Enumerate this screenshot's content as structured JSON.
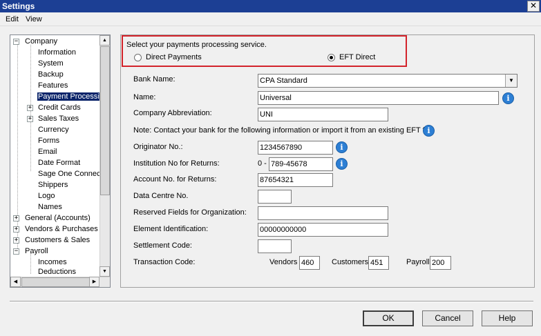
{
  "window": {
    "title": "Settings",
    "close_glyph": "✕"
  },
  "menu": {
    "items": [
      "Edit",
      "View"
    ]
  },
  "tree": {
    "items": [
      {
        "label": "Company",
        "expander": "−"
      },
      {
        "label": "Information"
      },
      {
        "label": "System"
      },
      {
        "label": "Backup"
      },
      {
        "label": "Features"
      },
      {
        "label": "Payment Processin",
        "selected": true
      },
      {
        "label": "Credit Cards",
        "expander": "+"
      },
      {
        "label": "Sales Taxes",
        "expander": "+"
      },
      {
        "label": "Currency"
      },
      {
        "label": "Forms"
      },
      {
        "label": "Email"
      },
      {
        "label": "Date Format"
      },
      {
        "label": "Sage One Connect"
      },
      {
        "label": "Shippers"
      },
      {
        "label": "Logo"
      },
      {
        "label": "Names"
      },
      {
        "label": "General (Accounts)",
        "expander": "+"
      },
      {
        "label": "Vendors & Purchases",
        "expander": "+"
      },
      {
        "label": "Customers & Sales",
        "expander": "+"
      },
      {
        "label": "Payroll",
        "expander": "−"
      },
      {
        "label": "Incomes"
      },
      {
        "label": "Deductions"
      }
    ],
    "scroll_up_glyph": "▲",
    "scroll_down_glyph": "▼",
    "scroll_left_glyph": "◀",
    "scroll_right_glyph": "▶"
  },
  "service": {
    "prompt": "Select your payments processing service.",
    "options": [
      {
        "label": "Direct Payments",
        "selected": false
      },
      {
        "label": "EFT Direct",
        "selected": true
      }
    ]
  },
  "form": {
    "bank_name_label": "Bank Name:",
    "bank_name_value": "CPA Standard",
    "combo_glyph": "▼",
    "name_label": "Name:",
    "name_value": "Universal",
    "abbrev_label": "Company Abbreviation:",
    "abbrev_value": "UNI",
    "note": "Note: Contact your bank for the following information or import it from an existing EFT file",
    "originator_label": "Originator No.:",
    "originator_value": "1234567890",
    "institution_label": "Institution No for Returns:",
    "institution_prefix": "0 -",
    "institution_value": "789-45678",
    "account_label": "Account No. for Returns:",
    "account_value": "87654321",
    "datacentre_label": "Data Centre No.",
    "datacentre_value": "",
    "reserved_label": "Reserved Fields for Organization:",
    "reserved_value": "",
    "element_label": "Element Identification:",
    "element_value": "00000000000",
    "settlement_label": "Settlement Code:",
    "settlement_value": "",
    "transaction_label": "Transaction Code:",
    "vendors_label": "Vendors",
    "vendors_value": "460",
    "customers_label": "Customers",
    "customers_value": "451",
    "payroll_label": "Payroll",
    "payroll_value": "200",
    "info_glyph": "i"
  },
  "buttons": {
    "ok": "OK",
    "cancel": "Cancel",
    "help": "Help"
  },
  "colors": {
    "titlebar": "#1c3f94",
    "highlight_box": "#d3222a",
    "selection": "#0a246a",
    "info_icon": "#2d7fd4"
  }
}
